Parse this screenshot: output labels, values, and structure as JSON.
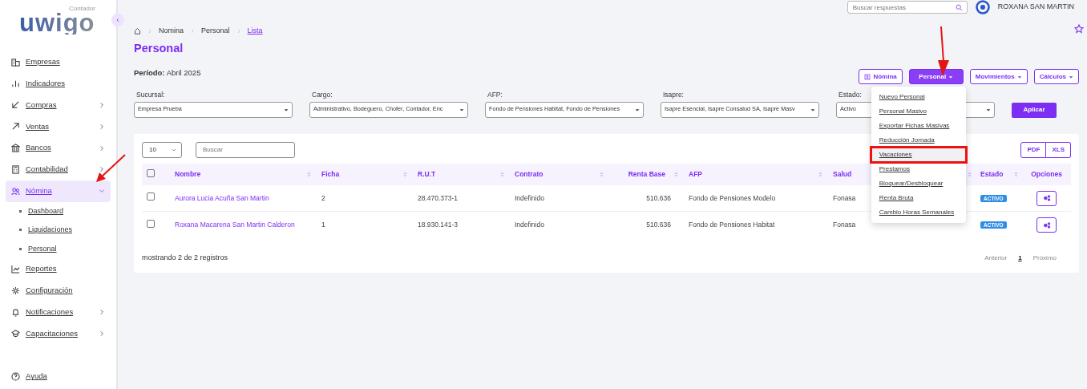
{
  "header": {
    "search": {
      "placeholder": "Buscar respuestas"
    },
    "user": "ROXANA SAN MARTIN"
  },
  "sidebar": {
    "logo": "uwigo",
    "logo_sub": "Contador",
    "collapse_button": "‹",
    "items": [
      {
        "label": "Empresas",
        "has_submenu": false,
        "expanded": false,
        "selected": false,
        "arrow_annotation": false
      },
      {
        "label": "Indicadores",
        "has_submenu": false,
        "expanded": false,
        "selected": false,
        "arrow_annotation": false
      },
      {
        "label": "Compras",
        "has_submenu": true,
        "expanded": false,
        "selected": false,
        "arrow_annotation": false
      },
      {
        "label": "Ventas",
        "has_submenu": true,
        "expanded": false,
        "selected": false,
        "arrow_annotation": false
      },
      {
        "label": "Bancos",
        "has_submenu": true,
        "expanded": false,
        "selected": false,
        "arrow_annotation": false
      },
      {
        "label": "Contabilidad",
        "has_submenu": true,
        "expanded": false,
        "selected": false,
        "arrow_annotation": false
      },
      {
        "label": "Nómina",
        "has_submenu": true,
        "expanded": true,
        "selected": true,
        "arrow_annotation": true,
        "children": [
          {
            "label": "Dashboard"
          },
          {
            "label": "Liquidaciones"
          },
          {
            "label": "Personal"
          }
        ]
      },
      {
        "label": "Reportes",
        "has_submenu": false,
        "expanded": false,
        "selected": false,
        "arrow_annotation": false
      },
      {
        "label": "Configuración",
        "has_submenu": false,
        "expanded": false,
        "selected": false,
        "arrow_annotation": false
      },
      {
        "label": "Notificaciones",
        "has_submenu": true,
        "expanded": false,
        "selected": false,
        "arrow_annotation": false
      },
      {
        "label": "Capacitaciones",
        "has_submenu": true,
        "expanded": false,
        "selected": false,
        "arrow_annotation": false
      }
    ],
    "footer_item": {
      "label": "Ayuda"
    }
  },
  "breadcrumb": [
    {
      "label": "Nomina",
      "selected": false
    },
    {
      "label": "Personal",
      "selected": false
    },
    {
      "label": "Lista",
      "selected": true
    }
  ],
  "page_title": "Personal",
  "period": {
    "label": "Período:",
    "value": "Abril 2025"
  },
  "actions": [
    {
      "label": "Nómina",
      "kind": "outline",
      "has_caret": false,
      "arrow_annotation": false
    },
    {
      "label": "Personal",
      "kind": "solid",
      "has_caret": true,
      "arrow_annotation": true
    },
    {
      "label": "Movimientos",
      "kind": "outline",
      "has_caret": true,
      "arrow_annotation": false
    },
    {
      "label": "Cálculos",
      "kind": "outline",
      "has_caret": true,
      "arrow_annotation": false
    }
  ],
  "dropdown_menu": [
    {
      "label": "Nuevo Personal",
      "highlighted": false
    },
    {
      "label": "Personal Masivo",
      "highlighted": false
    },
    {
      "label": "Exportar Fichas Masivas",
      "highlighted": false
    },
    {
      "label": "Reducción Jornada",
      "highlighted": false
    },
    {
      "label": "Vacaciones",
      "highlighted": true
    },
    {
      "label": "Prestamos",
      "highlighted": false
    },
    {
      "label": "Bloquear/Desbloquear",
      "highlighted": false
    },
    {
      "label": "Renta Bruta",
      "highlighted": false
    },
    {
      "label": "Cambio Horas Semanales",
      "highlighted": false
    }
  ],
  "filters": [
    {
      "label": "Sucursal:",
      "value": "Empresa Prueba"
    },
    {
      "label": "Cargo:",
      "value": "Administrativo, Bodeguero, Chofer, Contador, Enc"
    },
    {
      "label": "AFP:",
      "value": "Fondo de Pensiones Habitat, Fondo de Pensiones"
    },
    {
      "label": "Isapre:",
      "value": "Isapre Esencial, Isapre Consalud SA, Isapre Masv"
    },
    {
      "label": "Estado:",
      "value": "Activo"
    }
  ],
  "apply_button": "Aplicar",
  "table": {
    "select_all": {
      "checked": false
    },
    "page_size": "10",
    "search": {
      "placeholder": "Buscar"
    },
    "exports": [
      "PDF",
      "XLS"
    ],
    "columns": [
      {
        "label": "Nombre",
        "sortable": true,
        "kind": "link"
      },
      {
        "label": "Ficha",
        "sortable": true,
        "kind": "text"
      },
      {
        "label": "R.U.T",
        "sortable": true,
        "kind": "text"
      },
      {
        "label": "Contrato",
        "sortable": true,
        "kind": "text"
      },
      {
        "label": "Renta Base",
        "sortable": true,
        "kind": "number"
      },
      {
        "label": "AFP",
        "sortable": true,
        "kind": "text"
      },
      {
        "label": "Salud",
        "sortable": true,
        "kind": "text"
      },
      {
        "label": "Estado",
        "sortable": true,
        "kind": "badge"
      },
      {
        "label": "Opciones",
        "sortable": false,
        "kind": "options"
      }
    ],
    "rows": [
      {
        "checked": false,
        "cells": [
          "Aurora Lucia Acuña San Martin",
          "2",
          "28.470.373-1",
          "Indefinido",
          "510.636",
          "Fondo de Pensiones Modelo",
          "Fonasa",
          "ACTIVO"
        ]
      },
      {
        "checked": false,
        "cells": [
          "Roxana Macarena San Martin Calderon",
          "1",
          "18.930.141-3",
          "Indefinido",
          "510.636",
          "Fondo de Pensiones Habitat",
          "Fonasa",
          "ACTIVO"
        ]
      }
    ],
    "summary": "mostrando 2 de 2 registros",
    "pagination": [
      {
        "label": "Anterior",
        "selected": false
      },
      {
        "label": "1",
        "selected": true
      },
      {
        "label": "Próximo",
        "selected": false
      }
    ]
  }
}
